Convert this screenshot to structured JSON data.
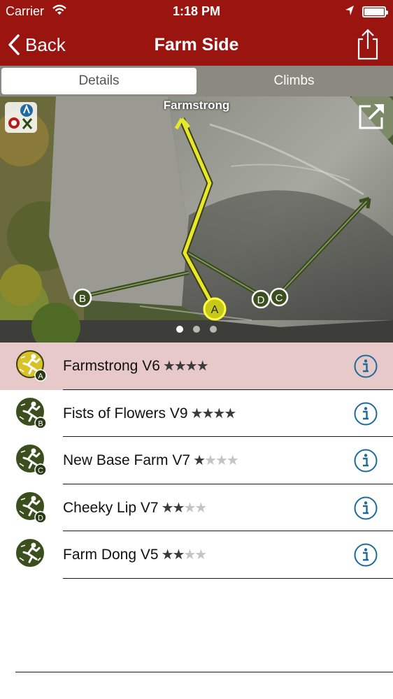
{
  "status": {
    "carrier": "Carrier",
    "time": "1:18 PM"
  },
  "nav": {
    "back_label": "Back",
    "title": "Farm Side"
  },
  "tabs": [
    {
      "label": "Details",
      "active": true
    },
    {
      "label": "Climbs",
      "active": false
    }
  ],
  "photo": {
    "route_title": "Farmstrong",
    "markers": [
      "A",
      "B",
      "C",
      "D"
    ],
    "page_dots": 3,
    "current_page": 1
  },
  "climbs": [
    {
      "name": "Farmstrong V6",
      "letter": "A",
      "stars": 4,
      "max_stars": 4,
      "selected": true
    },
    {
      "name": "Fists of Flowers V9",
      "letter": "B",
      "stars": 4,
      "max_stars": 4,
      "selected": false
    },
    {
      "name": "New Base Farm V7",
      "letter": "C",
      "stars": 1,
      "max_stars": 4,
      "selected": false
    },
    {
      "name": "Cheeky Lip V7",
      "letter": "D",
      "stars": 2,
      "max_stars": 4,
      "selected": false
    },
    {
      "name": "Farm Dong V5",
      "letter": "",
      "stars": 2,
      "max_stars": 4,
      "selected": false
    }
  ],
  "colors": {
    "brand": "#9a1410",
    "selected_row": "#e8c9c9",
    "route_green": "#3b4f1e",
    "route_yellow": "#e8e82a",
    "info_blue": "#1d6b9a"
  }
}
